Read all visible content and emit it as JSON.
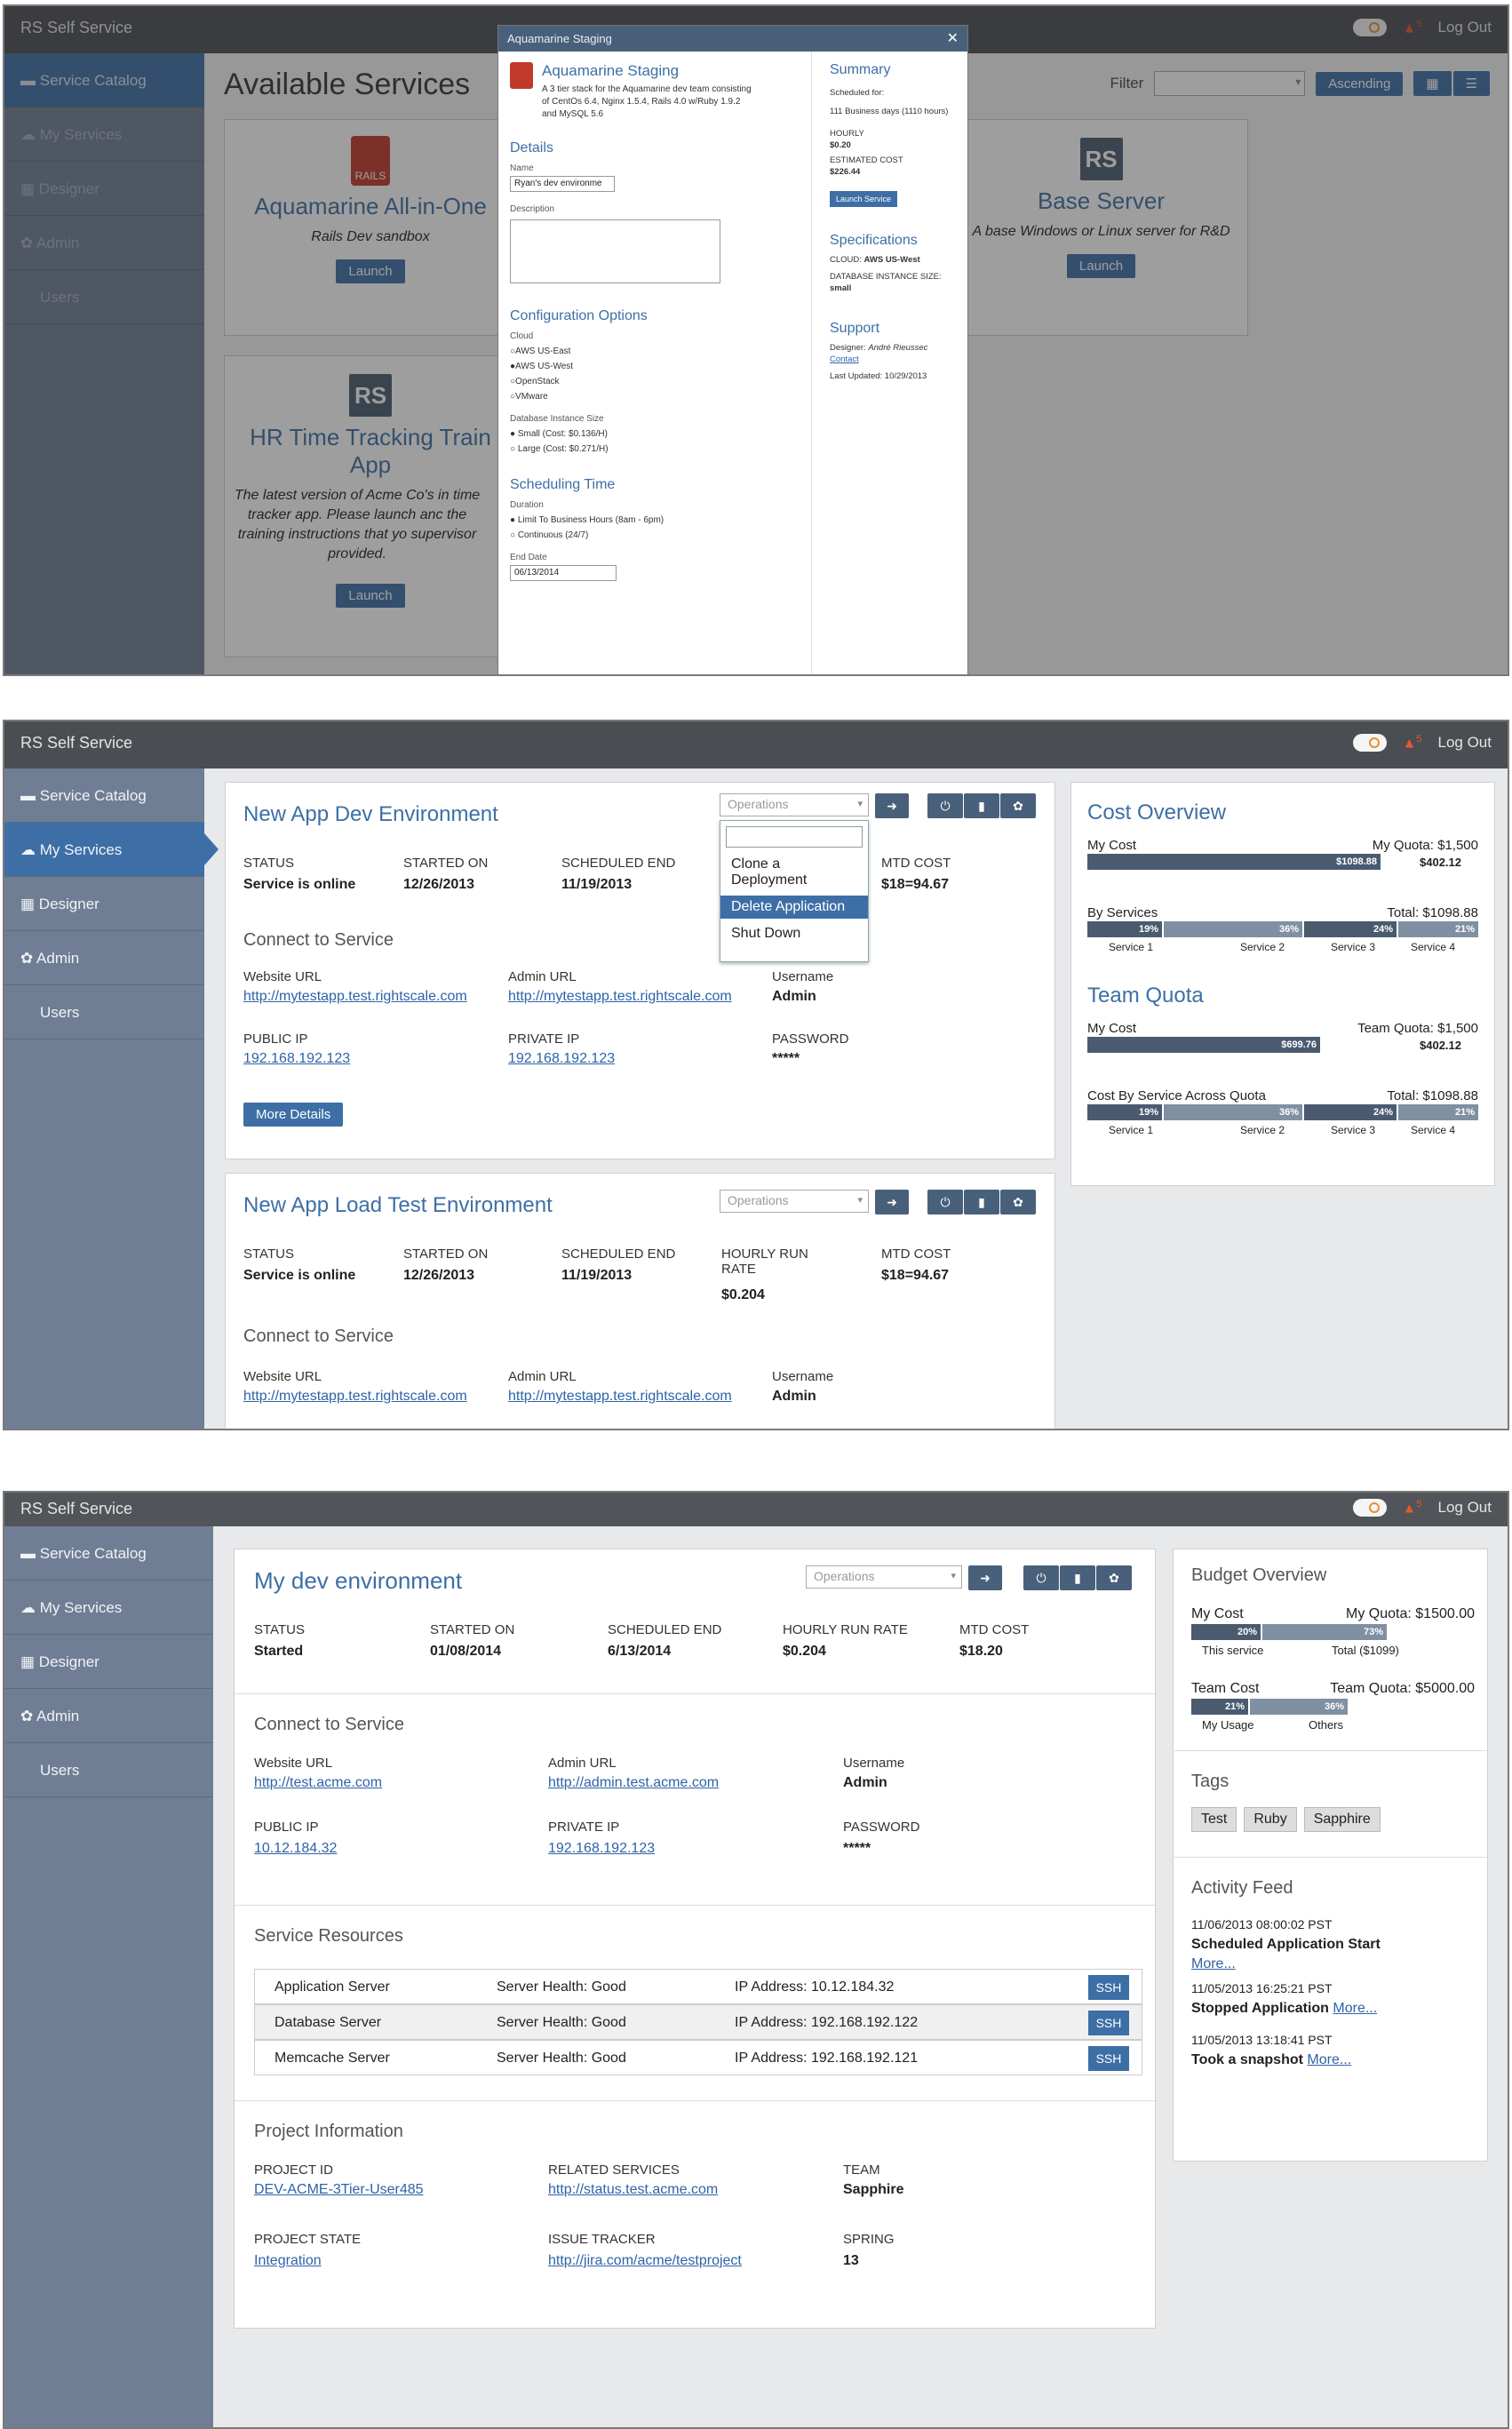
{
  "app": {
    "brand": "RS Self Service",
    "logout": "Log Out",
    "alert_count": "5"
  },
  "sidebar": {
    "items": [
      "Service Catalog",
      "My Services",
      "Designer",
      "Admin",
      "Users"
    ]
  },
  "screen1": {
    "title": "Available Services",
    "filter_label": "Filter",
    "sort": "Ascending",
    "cards": [
      {
        "title": "Aquamarine All-in-One",
        "desc": "Rails Dev sandbox",
        "launch": "Launch",
        "logo": "RAILS"
      },
      {
        "title": "Base Server",
        "desc": "A base Windows or Linux server for R&D",
        "launch": "Launch",
        "logo": "RS"
      },
      {
        "title": "HR Time Tracking Train App",
        "desc": "The latest version of Acme Co's in time tracker app. Please launch anc the training instructions that yo supervisor provided.",
        "launch": "Launch",
        "logo": "RS"
      }
    ],
    "modal": {
      "header": "Aquamarine Staging",
      "title": "Aquamarine Staging",
      "intro": "A 3 tier stack for the Aquamarine dev team consisting of CentOs 6.4, Nginx 1.5.4, Rails 4.0 w/Ruby 1.9.2 and MySQL 5.6",
      "details": "Details",
      "name_label": "Name",
      "name_value": "Ryan's dev environme",
      "desc_label": "Description",
      "config": "Configuration Options",
      "cloud_label": "Cloud",
      "clouds": [
        "AWS US-East",
        "AWS US-West",
        "OpenStack",
        "VMware"
      ],
      "db_label": "Database Instance Size",
      "db": [
        "Small (Cost: $0.136/H)",
        "Large (Cost: $0.271/H)"
      ],
      "sched": "Scheduling Time",
      "duration_label": "Duration",
      "durations": [
        "Limit To Business Hours (8am - 6pm)",
        "Continuous (24/7)"
      ],
      "end_label": "End Date",
      "end_value": "06/13/2014",
      "summary": "Summary",
      "sched_for": "Scheduled for:",
      "days": "111 Business days (1110 hours)",
      "hourly_label": "HOURLY",
      "hourly": "$0.20",
      "est_label": "ESTIMATED COST",
      "est": "$226.44",
      "launch_btn": "Launch Service",
      "specs": "Specifications",
      "cloud_spec_label": "CLOUD:",
      "cloud_spec": "AWS US-West",
      "db_spec_label": "DATABASE INSTANCE SIZE:",
      "db_spec": "small",
      "support": "Support",
      "designer_label": "Designer:",
      "designer": "André Rieussec",
      "contact": "Contact",
      "updated": "Last Updated: 10/29/2013"
    }
  },
  "screen2": {
    "card1": {
      "title": "New App Dev Environment",
      "ops": "Operations",
      "status_l": "STATUS",
      "status": "Service is online",
      "start_l": "STARTED ON",
      "start": "12/26/2013",
      "end_l": "SCHEDULED END",
      "end": "11/19/2013",
      "mtd_l": "MTD COST",
      "mtd": "$18=94.67",
      "connect": "Connect to Service",
      "web_l": "Website URL",
      "web": "http://mytestapp.test.rightscale.com",
      "admin_l": "Admin URL",
      "admin": "http://mytestapp.test.rightscale.com",
      "user_l": "Username",
      "user": "Admin",
      "pub_l": "PUBLIC IP",
      "pub": "192.168.192.123",
      "priv_l": "PRIVATE IP",
      "priv": "192.168.192.123",
      "pw_l": "PASSWORD",
      "pw": "*****",
      "more": "More Details",
      "menu": [
        "Clone a Deployment",
        "Delete Application",
        "Shut Down"
      ]
    },
    "card2": {
      "title": "New App Load Test Environment",
      "ops": "Operations",
      "status_l": "STATUS",
      "status": "Service is online",
      "start_l": "STARTED ON",
      "start": "12/26/2013",
      "end_l": "SCHEDULED END",
      "end": "11/19/2013",
      "rate_l": "HOURLY RUN RATE",
      "rate": "$0.204",
      "mtd_l": "MTD COST",
      "mtd": "$18=94.67",
      "connect": "Connect to Service",
      "web_l": "Website URL",
      "web": "http://mytestapp.test.rightscale.com",
      "admin_l": "Admin URL",
      "admin": "http://mytestapp.test.rightscale.com",
      "user_l": "Username",
      "user": "Admin"
    },
    "cost": {
      "title": "Cost Overview",
      "mycost": "My Cost",
      "quota": "My Quota: $1,500",
      "used": "$1098.88",
      "rem": "$402.12",
      "bysvc": "By Services",
      "total": "Total: $1098.88",
      "pcts": [
        "19%",
        "36%",
        "24%",
        "21%"
      ],
      "svcs": [
        "Service 1",
        "Service 2",
        "Service 3",
        "Service 4"
      ],
      "team": "Team Quota",
      "tmycost": "My Cost",
      "tquota": "Team Quota: $1,500",
      "tused": "$699.76",
      "trem": "$402.12",
      "across": "Cost By Service Across Quota",
      "atotal": "Total: $1098.88"
    }
  },
  "screen3": {
    "title": "My dev environment",
    "ops": "Operations",
    "status_l": "STATUS",
    "status": "Started",
    "start_l": "STARTED ON",
    "start": "01/08/2014",
    "end_l": "SCHEDULED END",
    "end": "6/13/2014",
    "rate_l": "HOURLY RUN RATE",
    "rate": "$0.204",
    "mtd_l": "MTD COST",
    "mtd": "$18.20",
    "connect": "Connect to Service",
    "web_l": "Website URL",
    "web": "http://test.acme.com",
    "admin_l": "Admin URL",
    "admin": "http://admin.test.acme.com",
    "user_l": "Username",
    "user": "Admin",
    "pub_l": "PUBLIC IP",
    "pub": "10.12.184.32",
    "priv_l": "PRIVATE IP",
    "priv": "192.168.192.123",
    "pw_l": "PASSWORD",
    "pw": "*****",
    "res_title": "Service Resources",
    "resources": [
      {
        "name": "Application Server",
        "health": "Server Health: Good",
        "ip": "IP Address: 10.12.184.32",
        "ssh": "SSH"
      },
      {
        "name": "Database Server",
        "health": "Server Health: Good",
        "ip": "IP Address: 192.168.192.122",
        "ssh": "SSH"
      },
      {
        "name": "Memcache Server",
        "health": "Server Health: Good",
        "ip": "IP Address: 192.168.192.121",
        "ssh": "SSH"
      }
    ],
    "proj_title": "Project Information",
    "pid_l": "PROJECT ID",
    "pid": "DEV-ACME-3Tier-User485",
    "rel_l": "RELATED SERVICES",
    "rel": "http://status.test.acme.com",
    "team_l": "TEAM",
    "team": "Sapphire",
    "state_l": "PROJECT STATE",
    "state": "Integration",
    "issue_l": "ISSUE TRACKER",
    "issue": "http://jira.com/acme/testproject",
    "spring_l": "SPRING",
    "spring": "13",
    "budget": {
      "title": "Budget Overview",
      "mycost": "My Cost",
      "quota": "My Quota: $1500.00",
      "p1": "20%",
      "p2": "73%",
      "this": "This service",
      "total": "Total ($1099)",
      "tcost": "Team Cost",
      "tquota": "Team Quota: $5000.00",
      "tp1": "21%",
      "tp2": "36%",
      "usage": "My Usage",
      "others": "Others"
    },
    "tags_title": "Tags",
    "tags": [
      "Test",
      "Ruby",
      "Sapphire"
    ],
    "feed_title": "Activity Feed",
    "feed": [
      {
        "time": "11/06/2013 08:00:02 PST",
        "text": "Scheduled Application Start",
        "more": "More..."
      },
      {
        "time": "11/05/2013 16:25:21 PST",
        "text": "Stopped Application",
        "more": "More..."
      },
      {
        "time": "11/05/2013 13:18:41 PST",
        "text": "Took a snapshot",
        "more": "More..."
      }
    ]
  }
}
